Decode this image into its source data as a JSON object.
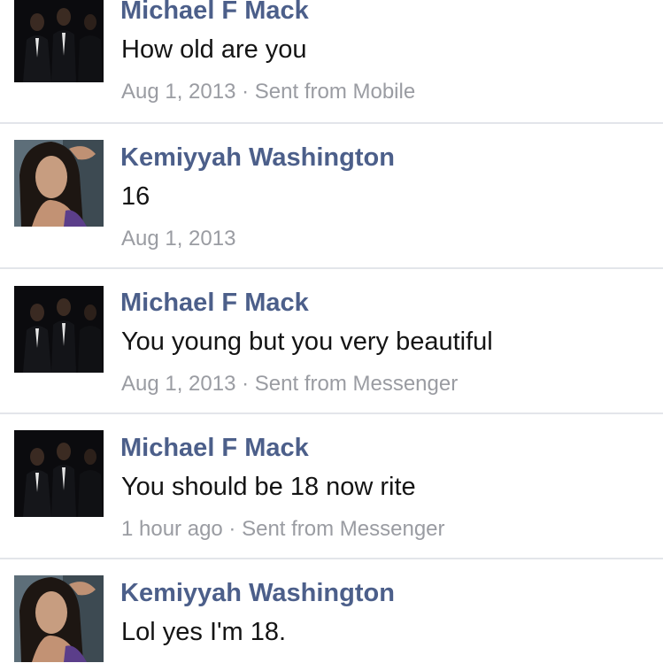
{
  "messages": [
    {
      "sender": "Michael F Mack",
      "text": "How old are you",
      "time": "Aug 1, 2013",
      "source": "Sent from Mobile",
      "avatar": "group-photo"
    },
    {
      "sender": "Kemiyyah Washington",
      "text": "16",
      "time": "Aug 1, 2013",
      "source": "",
      "avatar": "selfie-photo"
    },
    {
      "sender": "Michael F Mack",
      "text": "You young but you very beautiful",
      "time": "Aug 1, 2013",
      "source": "Sent from Messenger",
      "avatar": "group-photo"
    },
    {
      "sender": "Michael F Mack",
      "text": "You should be 18 now rite",
      "time": "1 hour ago",
      "source": "Sent from Messenger",
      "avatar": "group-photo"
    },
    {
      "sender": "Kemiyyah Washington",
      "text": "Lol yes I'm 18.",
      "time": "",
      "source": "",
      "avatar": "selfie-photo"
    }
  ],
  "meta_separator": " · ",
  "colors": {
    "name": "#4c5f8a",
    "text": "#141414",
    "meta": "#9a9ca2",
    "divider": "#e3e5ea"
  }
}
